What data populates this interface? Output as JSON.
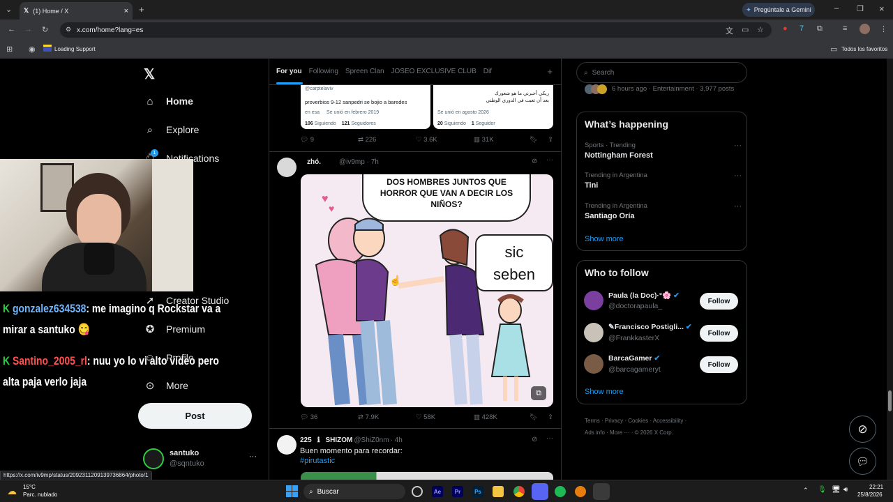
{
  "browser": {
    "tab_title": "(1) Home / X",
    "url": "x.com/home?lang=es",
    "gemini_label": "Pregúntale a Gemini",
    "bookmark": "Loading Support",
    "all_bookmarks": "Todos los favoritos",
    "status_url": "https://x.com/iv9mp/status/2092311209139736864/photo/1"
  },
  "sidebar": {
    "items": [
      {
        "label": "Home",
        "icon": "home-icon"
      },
      {
        "label": "Explore",
        "icon": "search-icon"
      },
      {
        "label": "Notifications",
        "icon": "bell-icon"
      },
      {
        "label": "Creator Studio",
        "icon": "rocket-icon"
      },
      {
        "label": "Premium",
        "icon": "x-verified-icon"
      },
      {
        "label": "Profile",
        "icon": "person-icon"
      },
      {
        "label": "More",
        "icon": "more-circle-icon"
      }
    ],
    "notif_badge": "1",
    "post_label": "Post",
    "account_name": "santuko",
    "account_handle": "@sqntuko",
    "account_more": "···"
  },
  "feed": {
    "tabs": [
      "For you",
      "Following",
      "Spreen Clan",
      "JOSEO EXCLUSIVE CLUB",
      "Dif"
    ],
    "prev_card": {
      "left_handle": "@carptelaviv",
      "left_bio": "proverbios 9-12 sanpedri se bojio a baredes",
      "left_location": "en esa",
      "left_joined": "Se unió en febrero 2019",
      "left_following": "106",
      "left_followers": "121",
      "right_bio_1": "ريكي أحبرني ما هو شعورك",
      "right_bio_2": "بعد أن تعبت في الدوري الوطني",
      "right_joined": "Se unió en agosto 2026",
      "right_following": "20",
      "right_followers": "1",
      "siguiendo": "Siguiendo",
      "seguidores": "Seguidores",
      "seguidor": "Seguidor"
    },
    "prev_actions": {
      "replies": "9",
      "reposts": "226",
      "likes": "3.6K",
      "views": "31K"
    },
    "post1": {
      "name": "zhó.",
      "handle": "@iv9mp",
      "time": "· 7h",
      "meme_top": "DOS HOMBRES JUNTOS QUE HORROR QUE VAN A DECIR LOS NIÑOS?",
      "meme_bubble_1": "sic",
      "meme_bubble_2": "seben",
      "actions": {
        "replies": "36",
        "reposts": "7.9K",
        "likes": "58K",
        "views": "428K"
      }
    },
    "post2": {
      "pre": "225",
      "name": "SHIZOM",
      "handle": "@ShiZ0nm",
      "time": "· 4h",
      "text": "Buen momento para recordar:",
      "hashtag": "#pirutastic"
    }
  },
  "right": {
    "search_placeholder": "Search",
    "top_meta": "6 hours ago · Entertainment · 3,977 posts",
    "happening_title": "What’s happening",
    "trends": [
      {
        "category": "Sports · Trending",
        "name": "Nottingham Forest"
      },
      {
        "category": "Trending in Argentina",
        "name": "Tini"
      },
      {
        "category": "Trending in Argentina",
        "name": "Santiago Oría"
      }
    ],
    "show_more": "Show more",
    "who_title": "Who to follow",
    "follow": [
      {
        "name": "Paula (la Doc)·°🌸",
        "handle": "@doctorapaula_"
      },
      {
        "name": "✎Francisco Postigli...",
        "handle": "@FrankkasterX"
      },
      {
        "name": "BarcaGamer",
        "handle": "@barcagameryt"
      }
    ],
    "follow_label": "Follow",
    "footer": [
      "Terms",
      "Privacy",
      "Cookies",
      "Accessibility",
      "Ads info",
      "More ···",
      "© 2026 X Corp."
    ]
  },
  "overlay": {
    "chat": [
      {
        "user": "gonzalez634538",
        "msg": ": me imagino q Rockstar va a",
        "msg2": "mirar a santuko"
      },
      {
        "user": "Santino_2005_rl",
        "msg": ": nuu yo lo vi alto video pero",
        "msg2": "alta paja verlo jaja"
      }
    ],
    "badge": "K"
  },
  "taskbar": {
    "weather_temp": "15°C",
    "weather_desc": "Parc. nublado",
    "search": "Buscar",
    "time": "22:21",
    "date": "25/8/2026"
  },
  "colors": {
    "accent": "#1d9bf0",
    "chat_user_1": "#6fb6ff",
    "chat_user_2": "#ff4f4f",
    "badge": "#2ecc40"
  }
}
